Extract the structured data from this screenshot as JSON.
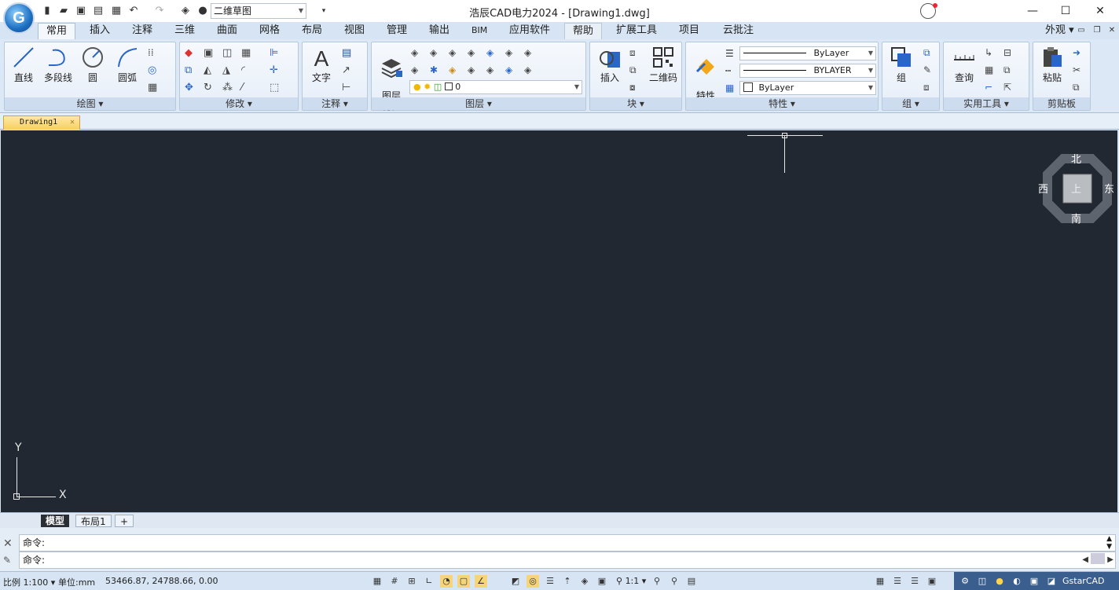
{
  "window": {
    "title": "浩辰CAD电力2024 - [Drawing1.dwg]",
    "workspace": "二维草图",
    "minimize": "—",
    "maximize": "☐",
    "close": "✕"
  },
  "quick_access": {
    "icons": [
      "new-file-icon",
      "open-folder-icon",
      "save-icon",
      "save-as-icon",
      "print-icon",
      "undo-icon",
      "redo-icon",
      "layers-icon",
      "comment-icon"
    ]
  },
  "ribbon_tabs": [
    "常用",
    "插入",
    "注释",
    "三维",
    "曲面",
    "网格",
    "布局",
    "视图",
    "管理",
    "输出",
    "BIM",
    "应用软件",
    "帮助",
    "扩展工具",
    "项目",
    "云批注"
  ],
  "appearance_label": "外观",
  "panels": {
    "draw": {
      "title": "绘图",
      "buttons": [
        "直线",
        "多段线",
        "圆",
        "圆弧"
      ]
    },
    "modify": {
      "title": "修改"
    },
    "annotate": {
      "title": "注释",
      "buttons": [
        "文字"
      ]
    },
    "layer": {
      "title": "图层",
      "buttons": [
        "图层\n特性"
      ],
      "layer_combo": "0"
    },
    "block": {
      "title": "块",
      "buttons": [
        "插入",
        "二维码"
      ]
    },
    "properties": {
      "title": "特性",
      "buttons": [
        "特性\n匹配"
      ],
      "linetype1": "ByLayer",
      "linetype2": "BYLAYER",
      "color": "ByLayer"
    },
    "group": {
      "title": "组",
      "buttons": [
        "组"
      ]
    },
    "utilities": {
      "title": "实用工具",
      "buttons": [
        "查询"
      ]
    },
    "clipboard": {
      "title": "剪贴板",
      "buttons": [
        "粘贴"
      ]
    }
  },
  "document_tab": {
    "label": "Drawing1",
    "close": "✕"
  },
  "viewcube": {
    "north": "北",
    "south": "南",
    "east": "东",
    "west": "西",
    "top": "上"
  },
  "ucs": {
    "x": "X",
    "y": "Y"
  },
  "layout_tabs": [
    "模型",
    "布局1",
    "+"
  ],
  "command": {
    "line1": "命令:",
    "line2": "命令:"
  },
  "status": {
    "scale": "比例 1:100",
    "units": "单位:mm",
    "coords": "53466.87, 24788.66, 0.00",
    "anno_scale": "1:1",
    "brand": "GstarCAD"
  }
}
